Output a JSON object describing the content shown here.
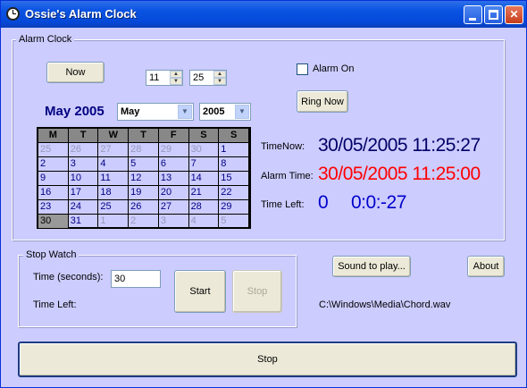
{
  "window": {
    "title": "Ossie's Alarm Clock"
  },
  "alarm_clock": {
    "group_label": "Alarm Clock",
    "now_button": "Now",
    "hour_value": "11",
    "minute_value": "25",
    "alarm_on_label": "Alarm On",
    "alarm_on_checked": false,
    "ring_now_button": "Ring Now",
    "month_year_heading": "May 2005",
    "month_select": "May",
    "year_select": "2005",
    "calendar": {
      "weekdays": [
        "M",
        "T",
        "W",
        "T",
        "F",
        "S",
        "S"
      ],
      "days": [
        "25",
        "26",
        "27",
        "28",
        "29",
        "30",
        "1",
        "2",
        "3",
        "4",
        "5",
        "6",
        "7",
        "8",
        "9",
        "10",
        "11",
        "12",
        "13",
        "14",
        "15",
        "16",
        "17",
        "18",
        "19",
        "20",
        "21",
        "22",
        "23",
        "24",
        "25",
        "26",
        "27",
        "28",
        "29",
        "30",
        "31",
        "1",
        "2",
        "3",
        "4",
        "5"
      ],
      "dim_indices": [
        0,
        1,
        2,
        3,
        4,
        5,
        37,
        38,
        39,
        40,
        41
      ],
      "selected_index": 35
    },
    "time_now_label": "TimeNow:",
    "time_now_value": "30/05/2005 11:25:27",
    "alarm_time_label": "Alarm Time:",
    "alarm_time_value": "30/05/2005 11:25:00",
    "time_left_label": "Time Left:",
    "time_left_days": "0",
    "time_left_value": "0:0:-27"
  },
  "stop_watch": {
    "group_label": "Stop Watch",
    "seconds_label": "Time (seconds):",
    "seconds_value": "30",
    "time_left_label": "Time Left:",
    "start_button": "Start",
    "stop_button": "Stop"
  },
  "sound_button": "Sound to play...",
  "about_button": "About",
  "sound_path": "C:\\Windows\\Media\\Chord.wav",
  "main_stop_button": "Stop",
  "colors": {
    "background": "#ccccff",
    "time_now": "#000066",
    "alarm_time": "#ff0000",
    "time_left": "#0000cc",
    "heading": "#000080"
  }
}
